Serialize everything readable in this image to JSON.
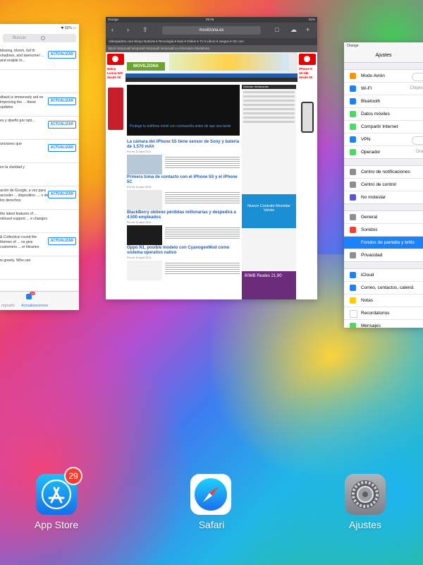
{
  "app_switcher": {
    "appstore_card": {
      "status": "✱ 92% ▭",
      "search_placeholder": "Buscar",
      "update_label": "ACTUALIZAR",
      "more_label": "más",
      "rows": [
        {
          "text": "blissing, bloom, full th shadows, and awesome! ... and enable In..."
        },
        {
          "text": ""
        },
        {
          "text": "dback is immensely ard on improving the ... these updates"
        },
        {
          "text": "es y diseño por opti..."
        },
        {
          "text": "unciones que"
        },
        {
          "text": "en la claridad y"
        },
        {
          "text": "ación de Google, a vez para acceder ... dispositivo. ... s de los derechos"
        },
        {
          "text": "the latest features of ... ntinued support ... e changes"
        },
        {
          "text": "& Collectica! round the themes of ... ns give customers ... er libraries."
        },
        {
          "text": "w gravity. Who can"
        }
      ],
      "tabs": [
        {
          "label": "mprado"
        },
        {
          "label": "Actualizaciones",
          "badge": "29"
        }
      ]
    },
    "safari_card": {
      "carrier": "Orange",
      "time": "09:08",
      "battery": "92%",
      "url": "movilzona.es",
      "bookmarks": "Videopadres.com  Simyo  Noticias ▾  Tecnología ▾  Nani ▾  Online ▾  TV ▾  Libros ▾  Juegos ▾  HC.com",
      "tabs": "Bsort   Vezpoxall   Vezpoxall   Vezpoxall   Vezpoxall   La informacio   MovilZona",
      "site_logo": "MOVILZONA",
      "left_ad": "Nokia Lumia 520 desde 0€",
      "right_ad": "iPhone 5 16 GB desde 0€",
      "hero_title": "Protege tu teléfono móvil con contraseña antes de que sea tarde",
      "articles": [
        {
          "title": "La cámara del iPhone 5S tiene sensor de Sony y batería de 1.570 mAh",
          "meta": "Por en 10 sept 2013"
        },
        {
          "title": "Primera toma de contacto con el iPhone 5S y el iPhone 5C",
          "meta": "Por en 10 sept 2013"
        },
        {
          "title": "BlackBerry obtiene pérdidas millonarias y despedirá a 4.500 empleados",
          "meta": "Por en 10 sept 2013"
        },
        {
          "title": "Oppo N1, posible modelo con CyanogenMod como sistema operativo nativo",
          "meta": "Por en 10 sept 2013"
        }
      ],
      "sidebar_head": "Noticias destacadas",
      "ad_blue": "Nuevo Contrato Movistar Veinte",
      "ad_purple": "60MB Reales 21,90"
    },
    "settings_card": {
      "status": "Orange",
      "title": "Ajustes",
      "groups": [
        [
          {
            "label": "Modo Avión",
            "icon_color": "#ff9500",
            "value": "",
            "toggle": true
          },
          {
            "label": "Wi-Fi",
            "icon_color": "#1a82fb",
            "value": "Chipirones"
          },
          {
            "label": "Bluetooth",
            "icon_color": "#1a82fb",
            "value": "Sí"
          },
          {
            "label": "Datos móviles",
            "icon_color": "#4cd964",
            "value": ""
          },
          {
            "label": "Compartir Internet",
            "icon_color": "#4cd964",
            "value": ""
          },
          {
            "label": "VPN",
            "icon_color": "#1a82fb",
            "value": "",
            "toggle": true
          },
          {
            "label": "Operador",
            "icon_color": "#4cd964",
            "value": "Orange"
          }
        ],
        [
          {
            "label": "Centro de notificaciones",
            "icon_color": "#8e8e93",
            "value": ""
          },
          {
            "label": "Centro de control",
            "icon_color": "#8e8e93",
            "value": ""
          },
          {
            "label": "No molestar",
            "icon_color": "#5856d6",
            "value": ""
          }
        ],
        [
          {
            "label": "General",
            "icon_color": "#8e8e93",
            "value": ""
          },
          {
            "label": "Sonidos",
            "icon_color": "#ff3b30",
            "value": ""
          },
          {
            "label": "Fondos de pantalla y brillo",
            "icon_color": "#1a82fb",
            "value": "",
            "selected": true
          },
          {
            "label": "Privacidad",
            "icon_color": "#8e8e93",
            "value": ""
          }
        ],
        [
          {
            "label": "iCloud",
            "icon_color": "#1a82fb",
            "value": ""
          },
          {
            "label": "Correo, contactos, calend.",
            "icon_color": "#1a82fb",
            "value": ""
          },
          {
            "label": "Notas",
            "icon_color": "#ffcc00",
            "value": ""
          },
          {
            "label": "Recordatorios",
            "icon_color": "#ffffff",
            "value": ""
          },
          {
            "label": "Mensajes",
            "icon_color": "#4cd964",
            "value": ""
          }
        ]
      ]
    }
  },
  "dock": {
    "appstore": {
      "label": "App Store",
      "badge": "29"
    },
    "safari": {
      "label": "Safari"
    },
    "settings": {
      "label": "Ajustes"
    }
  },
  "colors": {
    "ios_blue": "#1a82fb",
    "badge_red": "#ff3b30",
    "vodafone_red": "#e60000"
  }
}
